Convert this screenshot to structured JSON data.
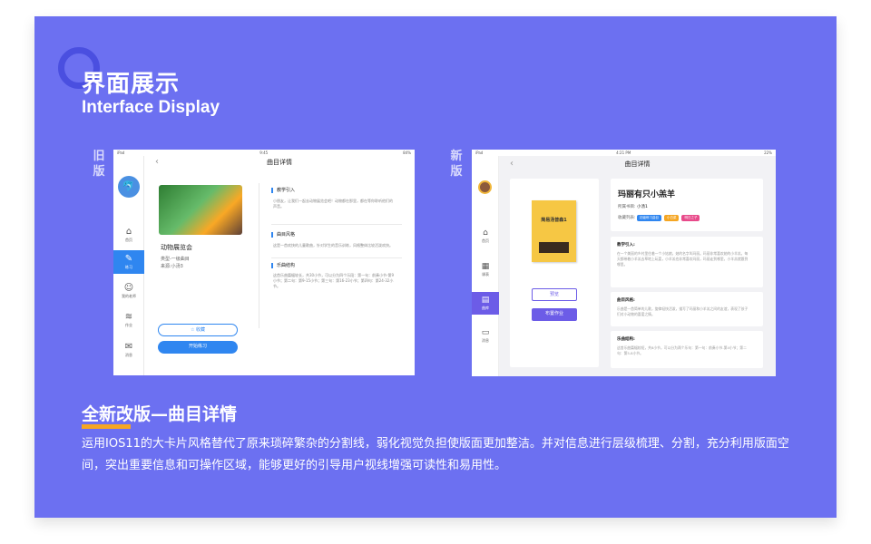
{
  "header": {
    "title": "界面展示",
    "subtitle": "Interface Display"
  },
  "labels": {
    "old": "旧版",
    "new": "新版"
  },
  "old_ui": {
    "status_left": "iPad",
    "status_center": "9:45",
    "status_right": "84%",
    "nav_title": "曲目详情",
    "nav_items": [
      "首页",
      "练习",
      "我的老师",
      "作业",
      "消息"
    ],
    "song_name": "动物展览会",
    "type": "类型-一级曲目",
    "source": "来源:小汤3",
    "collect_label": "收藏",
    "practice_label": "开始练习",
    "sections": [
      {
        "heading": "教学引入",
        "text": "小朋友，让我们一起去动物展览会吧！动物都在那里，都在等你聆听他们的声音。"
      },
      {
        "heading": "曲目风格",
        "text": "这是一首欢快的儿童歌曲，针对学生的音乐训练，风格整体比较活泼欢快。"
      },
      {
        "heading": "乐曲结构",
        "text": "这首乐曲篇幅较长，共30小节，可以分为四个乐段：第一句：前奏小节-第9小节；第二句：第9-15小节；第三句：第16-23小节；第四句：第24-32小节。"
      }
    ]
  },
  "new_ui": {
    "status_left": "iPad",
    "status_center": "4:21 PM",
    "status_right": "22%",
    "nav_title": "曲目详情",
    "nav_items": [
      "首页",
      "课表",
      "曲库",
      "消息"
    ],
    "book_title": "简易汤普森1",
    "preview_label": "预览",
    "assign_label": "布置作业",
    "song_title": "玛丽有只小羔羊",
    "book_meta_label": "所属书目:",
    "book_meta_value": "小汤1",
    "list_label": "收藏列表:",
    "tags": [
      "初级练习曲目",
      "小白菜",
      "明日之子"
    ],
    "tag_colors": [
      "#2f86f0",
      "#f5a623",
      "#e84a8a"
    ],
    "sections": [
      {
        "heading": "教学引入:",
        "text": "在一个美丽的乡村里住着一个小姑娘，她的名字叫玛丽。玛丽非常喜欢她的小羊羔，每天都带着小羊羔去草地上玩耍，小羊羔也非常喜欢玛丽，玛丽走到哪里，小羊羔就跟到哪里。"
      },
      {
        "heading": "曲目风格:",
        "text": "乐曲是一首简单的儿歌，旋律轻快活泼，描写了玛丽和小羊羔之间的友谊，表现了孩子们对小动物的喜爱之情。"
      },
      {
        "heading": "乐曲结构:",
        "text": "这首乐曲篇幅较短，共8小节，可以分为两个乐句：第一句：前奏小节-第4小节；第二句：第5-8小节。"
      }
    ]
  },
  "caption": {
    "title": "全新改版—曲目详情",
    "body": "运用IOS11的大卡片风格替代了原来琐碎繁杂的分割线，弱化视觉负担使版面更加整洁。并对信息进行层级梳理、分割，充分利用版面空间，突出重要信息和可操作区域，能够更好的引导用户视线增强可读性和易用性。"
  },
  "colors": {
    "panel": "#6c70f1",
    "old_accent": "#2f86f0",
    "new_accent": "#6c5ce7",
    "underline": "#f5a623"
  }
}
